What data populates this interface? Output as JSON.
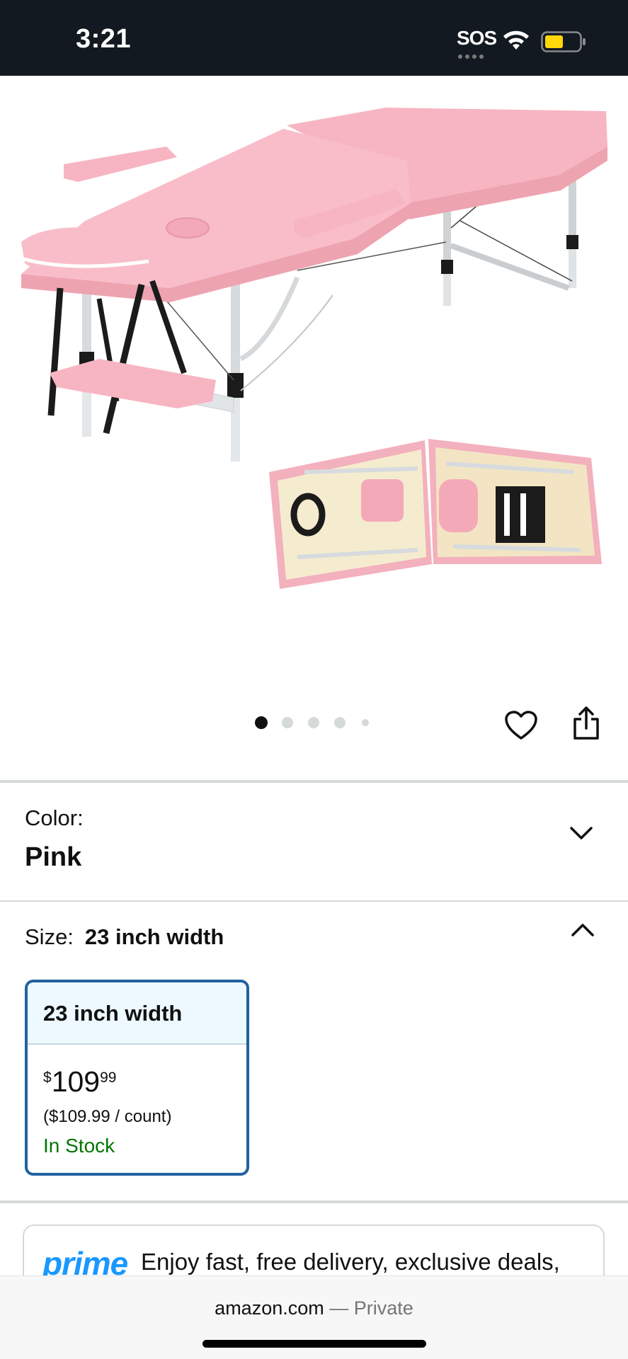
{
  "status_bar": {
    "time": "3:21",
    "sos": "SOS",
    "icons": [
      "wifi-icon",
      "battery-icon"
    ],
    "battery_color": "#ffd60a"
  },
  "product": {
    "image_description_icon": "massage-table-image",
    "carousel": {
      "total_dots": 5,
      "active_index": 0
    },
    "actions": [
      "heart-icon",
      "share-icon"
    ]
  },
  "color_selector": {
    "label": "Color:",
    "value": "Pink",
    "chevron": "chevron-down-icon"
  },
  "size_selector": {
    "label": "Size:",
    "value": "23 inch width",
    "chevron": "chevron-up-icon",
    "options": [
      {
        "name": "23 inch width",
        "price_symbol": "$",
        "price_whole": "109",
        "price_fraction": "99",
        "unit_price": "($109.99 / count)",
        "availability": "In Stock",
        "selected": true
      }
    ]
  },
  "prime": {
    "logo": "prime",
    "text": "Enjoy fast, free delivery, exclusive deals,"
  },
  "browser": {
    "domain": "amazon.com",
    "separator": " — ",
    "mode": "Private"
  },
  "colors": {
    "accent_blue": "#2162a1",
    "in_stock_green": "#007600",
    "prime_blue": "#1a98ff",
    "product_pink": "#f7b5c2"
  }
}
